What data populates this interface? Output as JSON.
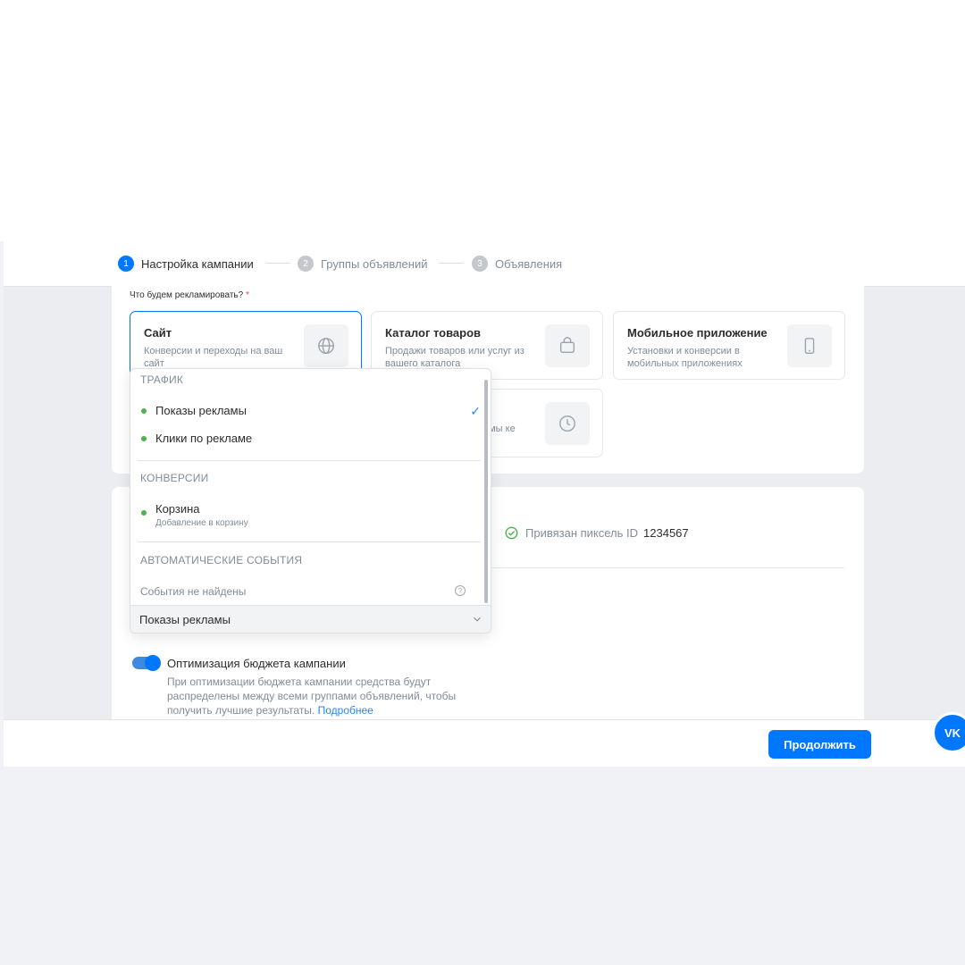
{
  "stepper": {
    "steps": [
      {
        "num": "1",
        "label": "Настройка кампании",
        "active": true
      },
      {
        "num": "2",
        "label": "Группы объявлений",
        "active": false
      },
      {
        "num": "3",
        "label": "Объявления",
        "active": false
      }
    ]
  },
  "objective": {
    "question": "Что будем рекламировать?",
    "required_mark": "*",
    "options": [
      {
        "title": "Сайт",
        "desc": "Конверсии и переходы на ваш сайт",
        "icon": "globe-icon",
        "selected": true
      },
      {
        "title": "Каталог товаров",
        "desc": "Продажи товаров или услуг из вашего каталога",
        "icon": "shopping-bag-icon",
        "selected": false
      },
      {
        "title": "Мобильное приложение",
        "desc": "Установки и конверсии в мобильных приложениях",
        "icon": "phone-icon",
        "selected": false
      },
      {
        "title": "",
        "desc": "амы ке",
        "icon": "clock-icon",
        "selected": false
      }
    ]
  },
  "dropdown": {
    "groups": [
      {
        "label": "ТРАФИК",
        "items": [
          {
            "label": "Показы рекламы",
            "checked": true
          },
          {
            "label": "Клики по рекламе",
            "checked": false
          }
        ]
      },
      {
        "label": "КОНВЕРСИИ",
        "items": [
          {
            "label": "Корзина",
            "sub": "Добавление в корзину",
            "checked": false
          }
        ]
      },
      {
        "label": "АВТОМАТИЧЕСКИЕ СОБЫТИЯ",
        "empty": "События не найдены"
      }
    ],
    "selected_value": "Показы рекламы"
  },
  "pixel": {
    "label": "Привязан пиксель ID",
    "value": "1234567"
  },
  "budget": {
    "title": "Оптимизация бюджета кампании",
    "desc": "При оптимизации бюджета кампании средства будут распределены между всеми группами объявлений, чтобы получить лучшие результаты.",
    "link": "Подробнее",
    "enabled": true
  },
  "footer": {
    "continue_label": "Продолжить"
  },
  "widget": {
    "label": "VK"
  },
  "colors": {
    "accent": "#0077ff",
    "success": "#4bb34b"
  }
}
